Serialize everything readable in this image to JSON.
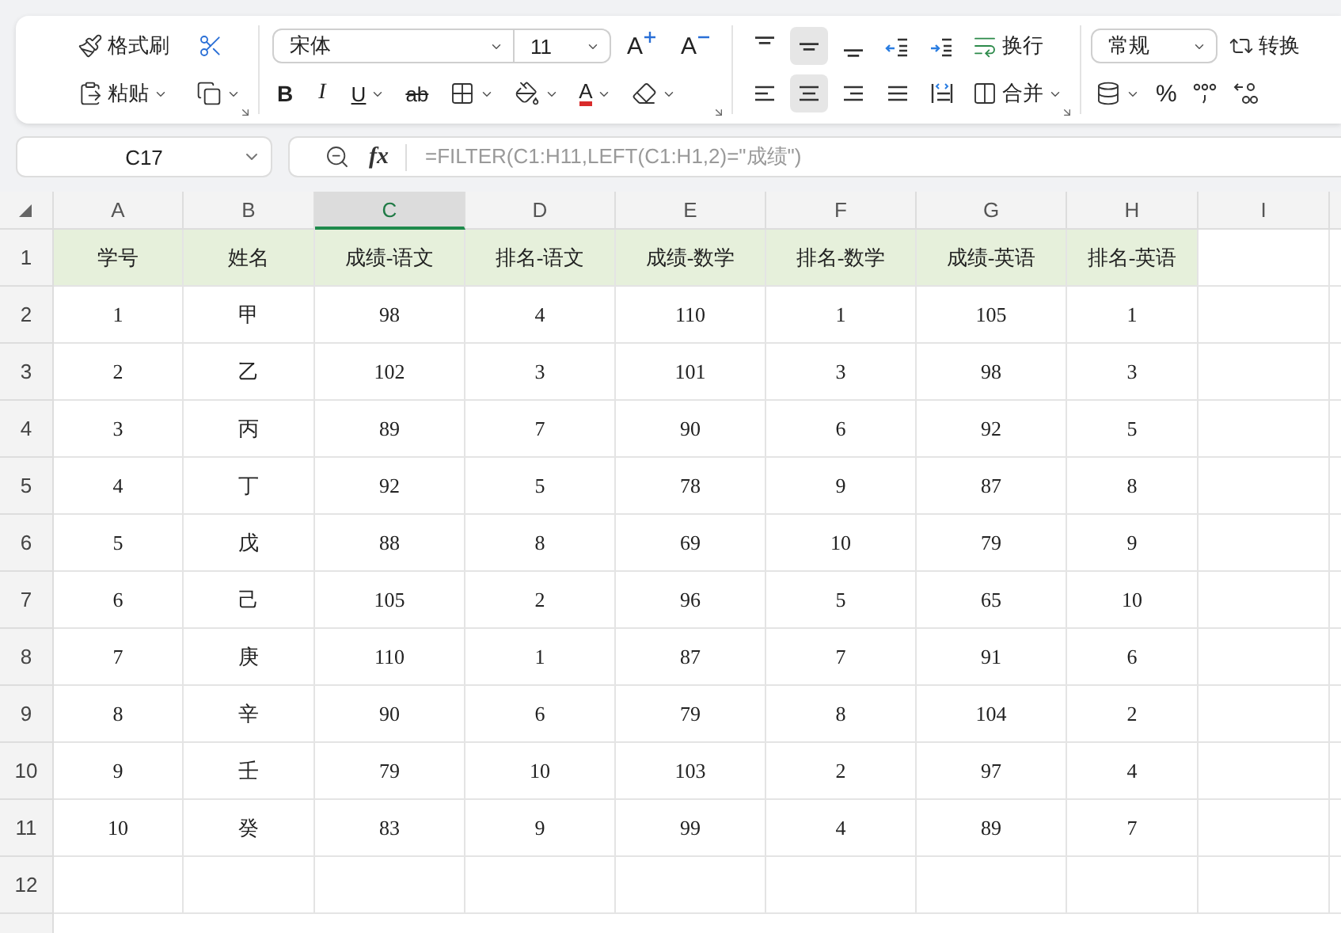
{
  "ribbon": {
    "clipboard": {
      "format_painter": "格式刷",
      "paste": "粘贴"
    },
    "font": {
      "font_name": "宋体",
      "font_size": "11",
      "grow": "A",
      "shrink": "A",
      "bold": "B",
      "italic": "I",
      "underline": "U",
      "strike": "ab",
      "font_color": "A"
    },
    "alignment": {
      "vertical": [
        {
          "kind": "top",
          "selected": false
        },
        {
          "kind": "middle",
          "selected": true
        },
        {
          "kind": "bottom",
          "selected": false
        },
        {
          "kind": "outdent",
          "selected": false
        },
        {
          "kind": "indent",
          "selected": false
        }
      ],
      "horizontal": [
        {
          "kind": "left",
          "selected": false
        },
        {
          "kind": "center",
          "selected": true
        },
        {
          "kind": "right",
          "selected": false
        },
        {
          "kind": "justify",
          "selected": false
        },
        {
          "kind": "distributed",
          "selected": false
        }
      ],
      "wrap": "换行",
      "merge": "合并"
    },
    "number": {
      "format": "常规",
      "convert": "转换",
      "percent": "%"
    }
  },
  "formula_bar": {
    "name_box": "C17",
    "fx": "fx",
    "formula": "=FILTER(C1:H11,LEFT(C1:H1,2)=\"成绩\")"
  },
  "sheet": {
    "columns": [
      {
        "label": "A",
        "selected": false
      },
      {
        "label": "B",
        "selected": false
      },
      {
        "label": "C",
        "selected": true
      },
      {
        "label": "D",
        "selected": false
      },
      {
        "label": "E",
        "selected": false
      },
      {
        "label": "F",
        "selected": false
      },
      {
        "label": "G",
        "selected": false
      },
      {
        "label": "H",
        "selected": false
      },
      {
        "label": "I",
        "selected": false
      }
    ],
    "rows": [
      {
        "number": "1",
        "header": true,
        "cells": [
          "学号",
          "姓名",
          "成绩-语文",
          "排名-语文",
          "成绩-数学",
          "排名-数学",
          "成绩-英语",
          "排名-英语"
        ]
      },
      {
        "number": "2",
        "header": false,
        "cells": [
          "1",
          "甲",
          "98",
          "4",
          "110",
          "1",
          "105",
          "1"
        ]
      },
      {
        "number": "3",
        "header": false,
        "cells": [
          "2",
          "乙",
          "102",
          "3",
          "101",
          "3",
          "98",
          "3"
        ]
      },
      {
        "number": "4",
        "header": false,
        "cells": [
          "3",
          "丙",
          "89",
          "7",
          "90",
          "6",
          "92",
          "5"
        ]
      },
      {
        "number": "5",
        "header": false,
        "cells": [
          "4",
          "丁",
          "92",
          "5",
          "78",
          "9",
          "87",
          "8"
        ]
      },
      {
        "number": "6",
        "header": false,
        "cells": [
          "5",
          "戊",
          "88",
          "8",
          "69",
          "10",
          "79",
          "9"
        ]
      },
      {
        "number": "7",
        "header": false,
        "cells": [
          "6",
          "己",
          "105",
          "2",
          "96",
          "5",
          "65",
          "10"
        ]
      },
      {
        "number": "8",
        "header": false,
        "cells": [
          "7",
          "庚",
          "110",
          "1",
          "87",
          "7",
          "91",
          "6"
        ]
      },
      {
        "number": "9",
        "header": false,
        "cells": [
          "8",
          "辛",
          "90",
          "6",
          "79",
          "8",
          "104",
          "2"
        ]
      },
      {
        "number": "10",
        "header": false,
        "cells": [
          "9",
          "壬",
          "79",
          "10",
          "103",
          "2",
          "97",
          "4"
        ]
      },
      {
        "number": "11",
        "header": false,
        "cells": [
          "10",
          "癸",
          "83",
          "9",
          "99",
          "4",
          "89",
          "7"
        ]
      },
      {
        "number": "12",
        "header": false,
        "cells": []
      }
    ]
  }
}
